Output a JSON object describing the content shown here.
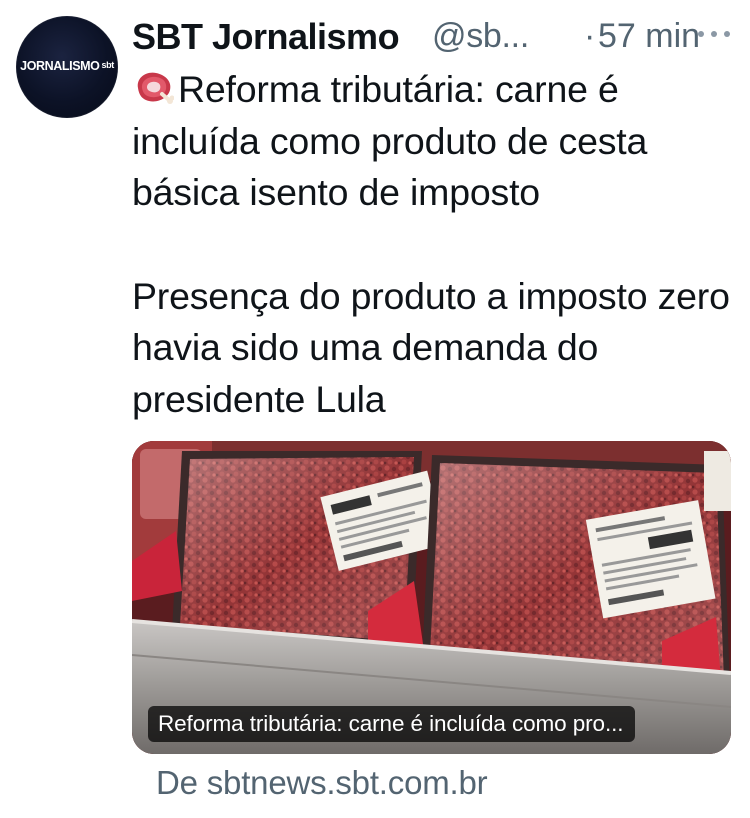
{
  "tweet": {
    "avatar_text": "JORNALISMO",
    "avatar_sub": "sbt",
    "author_name": "SBT Jornalismo",
    "handle": "@sb...",
    "separator": "·",
    "time": "57 min",
    "more_icon": "more-horizontal-icon",
    "emoji": "meat-on-bone",
    "paragraph_1": "Reforma tributária: carne é incluída como produto de cesta básica isento de imposto",
    "paragraph_2": "Presença do produto a imposto zero havia sido uma demanda do presidente Lula"
  },
  "card": {
    "image_alt": "packaged ground beef trays in a supermarket fridge",
    "caption": "Reforma tributária: carne é incluída como pro...",
    "source": "De sbtnews.sbt.com.br"
  },
  "colors": {
    "text_primary": "#0f1419",
    "text_secondary": "#536471",
    "background": "#ffffff"
  }
}
